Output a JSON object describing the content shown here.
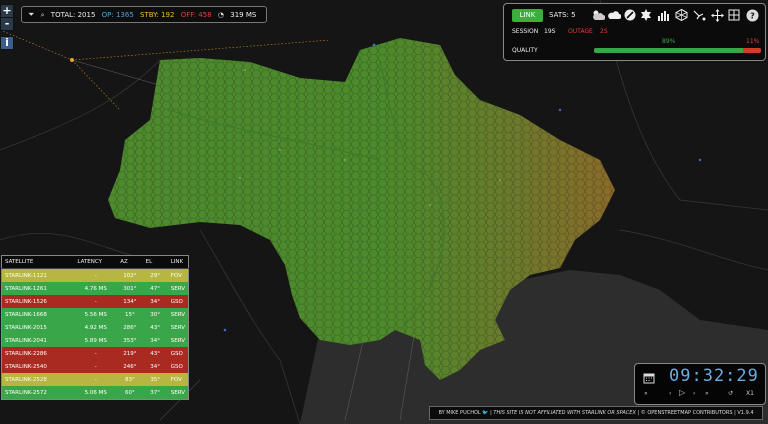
{
  "stats_bar": {
    "total": "TOTAL: 2015",
    "op": "OP: 1365",
    "stby": "STBY: 192",
    "off": "OFF: 458",
    "latency": "319 MS"
  },
  "colors": {
    "op": "#4fa3e0",
    "stby": "#e8c020",
    "off": "#e04040",
    "serv": "#3aa64a",
    "fov": "#b6b640",
    "gso": "#a82a20",
    "clock": "#69aee0"
  },
  "status_panel": {
    "link_label": "LINK",
    "sats": "SATS: 5",
    "session_label": "SESSION",
    "session_value": "19S",
    "outage_label": "OUTAGE",
    "outage_value": "2S",
    "quality_label": "QUALITY",
    "quality_good": "89%",
    "quality_bad": "11%",
    "quality_good_fraction": 0.89,
    "quality_bad_fraction": 0.11
  },
  "toolbar_icons": [
    "cloud-sun-icon",
    "cloud-icon",
    "moon-icon",
    "sun-icon",
    "bar-chart-icon",
    "sphere-grid-icon",
    "satellite-icon",
    "move-icon",
    "map-icon",
    "help-icon"
  ],
  "table": {
    "headers": [
      "SATELLITE",
      "LATENCY",
      "AZ",
      "EL",
      "LINK"
    ],
    "rows": [
      {
        "name": "STARLINK-1121",
        "latency": "-",
        "az": "102°",
        "el": "29°",
        "link": "FOV",
        "status": "fov"
      },
      {
        "name": "STARLINK-1261",
        "latency": "4.76 MS",
        "az": "301°",
        "el": "47°",
        "link": "SERV",
        "status": "serv"
      },
      {
        "name": "STARLINK-1526",
        "latency": "-",
        "az": "134°",
        "el": "34°",
        "link": "GSO",
        "status": "gso"
      },
      {
        "name": "STARLINK-1668",
        "latency": "5.56 MS",
        "az": "15°",
        "el": "30°",
        "link": "SERV",
        "status": "serv"
      },
      {
        "name": "STARLINK-2015",
        "latency": "4.92 MS",
        "az": "286°",
        "el": "43°",
        "link": "SERV",
        "status": "serv"
      },
      {
        "name": "STARLINK-2041",
        "latency": "5.89 MS",
        "az": "353°",
        "el": "34°",
        "link": "SERV",
        "status": "serv"
      },
      {
        "name": "STARLINK-2286",
        "latency": "-",
        "az": "219°",
        "el": "43°",
        "link": "GSO",
        "status": "gso"
      },
      {
        "name": "STARLINK-2540",
        "latency": "-",
        "az": "246°",
        "el": "34°",
        "link": "GSO",
        "status": "gso"
      },
      {
        "name": "STARLINK-2528",
        "latency": "-",
        "az": "83°",
        "el": "35°",
        "link": "FOV",
        "status": "fov"
      },
      {
        "name": "STARLINK-2572",
        "latency": "5.06 MS",
        "az": "60°",
        "el": "37°",
        "link": "SERV",
        "status": "serv"
      }
    ]
  },
  "credits": {
    "author": "BY MIKE PUCHOL",
    "disclaimer": "THIS SITE IS NOT AFFILIATED WITH STARLINK OR SPACEX",
    "osm": "© OPENSTREETMAP CONTRIBUTORS",
    "version": "V1.9.4"
  },
  "clock": {
    "time": "09:32:29",
    "speed": "X1"
  },
  "zoom": {
    "in": "+",
    "out": "-",
    "info": "i"
  }
}
